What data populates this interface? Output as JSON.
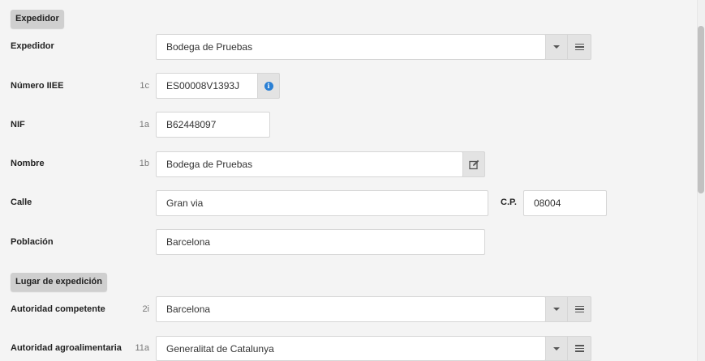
{
  "sections": {
    "expedidor_title": "Expedidor",
    "lugar_title": "Lugar de expedición"
  },
  "expedidor": {
    "label": "Expedidor",
    "value": "Bodega de Pruebas",
    "toggle_icon": "chevron-down-icon",
    "list_icon": "list-icon"
  },
  "numero_iiee": {
    "label": "Número IIEE",
    "code": "1c",
    "value": "ES00008V1393J",
    "icon": "info-icon",
    "icon_glyph": "i"
  },
  "nif": {
    "label": "NIF",
    "code": "1a",
    "value": "B62448097"
  },
  "nombre": {
    "label": "Nombre",
    "code": "1b",
    "value": "Bodega de Pruebas",
    "icon": "edit-icon"
  },
  "calle": {
    "label": "Calle",
    "value": "Gran via"
  },
  "cp": {
    "label": "C.P.",
    "value": "08004"
  },
  "poblacion": {
    "label": "Población",
    "value": "Barcelona"
  },
  "autoridad_competente": {
    "label": "Autoridad competente",
    "code": "2i",
    "value": "Barcelona"
  },
  "autoridad_agroalimentaria": {
    "label": "Autoridad agroalimentaria",
    "code": "11a",
    "value": "Generalitat de Catalunya"
  },
  "colors": {
    "page_bg": "#f4f4f4",
    "badge_bg": "#cfcfcf",
    "addon_bg": "#e3e3e3",
    "info_blue": "#2a7fd4"
  }
}
